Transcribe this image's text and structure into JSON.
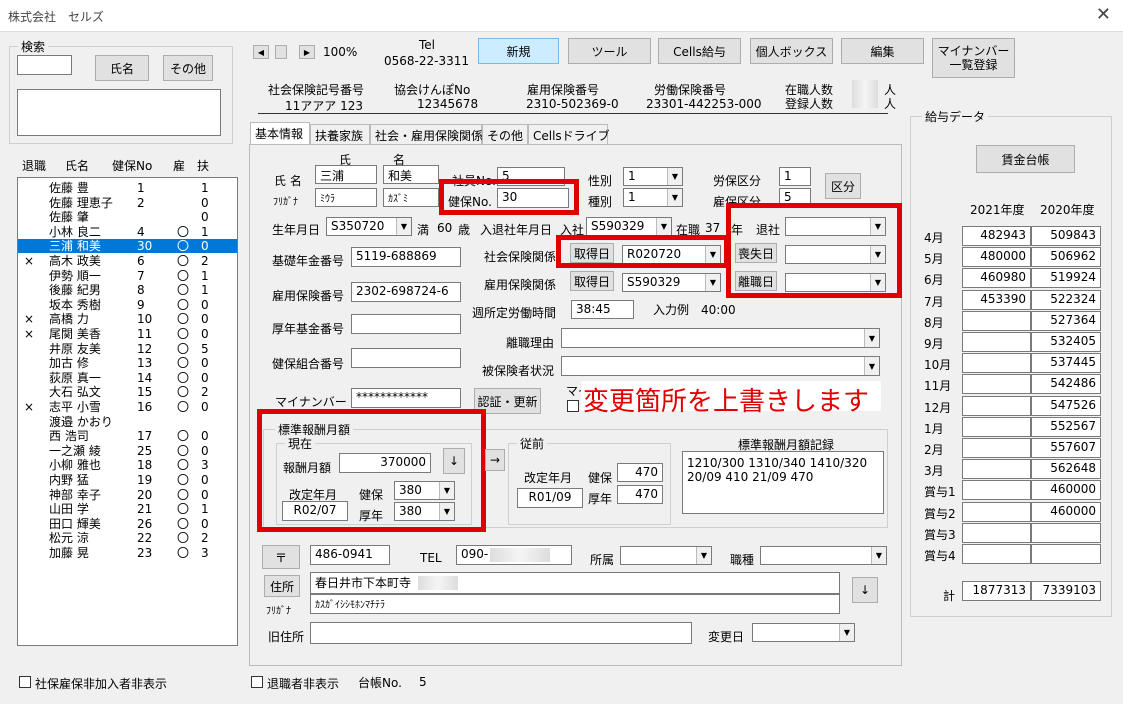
{
  "window": {
    "title": "株式会社　セルズ",
    "close": "✕"
  },
  "search": {
    "title": "検索",
    "name_btn": "氏名",
    "other_btn": "その他"
  },
  "list": {
    "headers": [
      "退職",
      "氏名",
      "健保No",
      "扶",
      "扶"
    ],
    "header_labels": {
      "retire": "退職",
      "name": "氏名",
      "no": "健保No",
      "ko": "雇",
      "fu": "扶"
    },
    "rows": [
      {
        "m": "",
        "n": "佐藤 豊",
        "no": "1",
        "c": "",
        "f": "1"
      },
      {
        "m": "",
        "n": "佐藤 理恵子",
        "no": "2",
        "c": "",
        "f": "0"
      },
      {
        "m": "",
        "n": "佐藤 肇",
        "no": "",
        "c": "",
        "f": "0"
      },
      {
        "m": "",
        "n": "小林 良二",
        "no": "4",
        "c": "〇",
        "f": "1"
      },
      {
        "m": "",
        "n": "三浦 和美",
        "no": "30",
        "c": "〇",
        "f": "0"
      },
      {
        "m": "×",
        "n": "高木 政美",
        "no": "6",
        "c": "〇",
        "f": "2"
      },
      {
        "m": "",
        "n": "伊勢 順一",
        "no": "7",
        "c": "〇",
        "f": "1"
      },
      {
        "m": "",
        "n": "後藤 紀男",
        "no": "8",
        "c": "〇",
        "f": "1"
      },
      {
        "m": "",
        "n": "坂本 秀樹",
        "no": "9",
        "c": "〇",
        "f": "0"
      },
      {
        "m": "×",
        "n": "高橋 力",
        "no": "10",
        "c": "〇",
        "f": "0"
      },
      {
        "m": "×",
        "n": "尾関 美香",
        "no": "11",
        "c": "〇",
        "f": "0"
      },
      {
        "m": "",
        "n": "井原 友美",
        "no": "12",
        "c": "〇",
        "f": "5"
      },
      {
        "m": "",
        "n": "加古 修",
        "no": "13",
        "c": "〇",
        "f": "0"
      },
      {
        "m": "",
        "n": "荻原 真一",
        "no": "14",
        "c": "〇",
        "f": "0"
      },
      {
        "m": "",
        "n": "大石 弘文",
        "no": "15",
        "c": "〇",
        "f": "2"
      },
      {
        "m": "×",
        "n": "志平 小雪",
        "no": "16",
        "c": "〇",
        "f": "0"
      },
      {
        "m": "",
        "n": "渡邉 かおり",
        "no": "",
        "c": "",
        "f": ""
      },
      {
        "m": "",
        "n": "西 浩司",
        "no": "17",
        "c": "〇",
        "f": "0"
      },
      {
        "m": "",
        "n": "一之瀬 綾",
        "no": "25",
        "c": "〇",
        "f": "0"
      },
      {
        "m": "",
        "n": "小柳 雅也",
        "no": "18",
        "c": "〇",
        "f": "3"
      },
      {
        "m": "",
        "n": "内野 猛",
        "no": "19",
        "c": "〇",
        "f": "0"
      },
      {
        "m": "",
        "n": "神部 幸子",
        "no": "20",
        "c": "〇",
        "f": "0"
      },
      {
        "m": "",
        "n": "山田 学",
        "no": "21",
        "c": "〇",
        "f": "1"
      },
      {
        "m": "",
        "n": "田口 輝美",
        "no": "26",
        "c": "〇",
        "f": "0"
      },
      {
        "m": "",
        "n": "松元 涼",
        "no": "22",
        "c": "〇",
        "f": "2"
      },
      {
        "m": "",
        "n": "加藤 晃",
        "no": "23",
        "c": "〇",
        "f": "3"
      }
    ],
    "selected_index": 4
  },
  "bottom": {
    "hide_unenrolled": "社保雇保非加入者非表示",
    "hide_retired": "退職者非表示",
    "ledger_label": "台帳No.",
    "ledger_no": "5"
  },
  "toolbar": {
    "zoom": "100%",
    "tel_label": "Tel",
    "tel": "0568-22-3311",
    "buttons": [
      "新規",
      "ツール",
      "Cells給与",
      "個人ボックス",
      "編集"
    ],
    "mynumber_btn": "マイナンバー\n一覧登録"
  },
  "company": {
    "shaho_label": "社会保険記号番号",
    "shaho": "11アアア 123",
    "kyokai_label": "協会けんぽNo",
    "kyokai": "12345678",
    "koyo_label": "雇用保険番号",
    "koyo": "2310-502369-0",
    "rodo_label": "労働保険番号",
    "rodo": "23301-442253-000",
    "zaishoku_label": "在職人数",
    "toroku_label": "登録人数",
    "unit": "人"
  },
  "tabs": [
    "基本情報",
    "扶養家族",
    "社会・雇用保険関係",
    "その他",
    "Cellsドライブ"
  ],
  "basic": {
    "sei_label": "氏",
    "mei_label": "名",
    "name_label": "氏 名",
    "furi_label": "ﾌﾘｶﾞﾅ",
    "sei": "三浦",
    "mei": "和美",
    "sei_kana": "ﾐｳﾗ",
    "mei_kana": "ｶｽﾞﾐ",
    "shain_label": "社員No.",
    "shain": "5",
    "kenpo_label": "健保No.",
    "kenpo": "30",
    "seibetsu_label": "性別",
    "seibetsu": "1",
    "shubetsu_label": "種別",
    "shubetsu": "1",
    "rodo_kubun_label": "労保区分",
    "rodo_kubun": "1",
    "koho_kubun_label": "雇保区分",
    "koho_kubun": "5",
    "kubun_btn": "区分",
    "birth_label": "生年月日",
    "birth": "S350720",
    "age_prefix": "満",
    "age": "60",
    "age_unit": "歳",
    "nyutai_label": "入退社年月日",
    "nyusha_label": "入社",
    "nyusha": "S590329",
    "zaishoku_label": "在職",
    "zaishoku": "37",
    "zaishoku_unit": "年",
    "taisha_label": "退社",
    "kiso_label": "基礎年金番号",
    "kiso": "5119-688869",
    "koyo_label": "雇用保険番号",
    "koyo": "2302-698724-6",
    "kosei_label": "厚年基金番号",
    "kenpo_kumiai_label": "健保組合番号",
    "shakai_label": "社会保険関係",
    "shutoku_btn": "取得日",
    "shakai_shutoku": "R020720",
    "soshitsu_btn": "喪失日",
    "koyo_kankei_label": "雇用保険関係",
    "koyo_shutoku": "S590329",
    "rishoku_btn": "離職日",
    "rodo_jikan_label": "週所定労働時間",
    "rodo_jikan": "38:45",
    "example": "入力例　40:00",
    "rishoku_riyu_label": "離職理由",
    "hihoken_label": "被保険者状況",
    "mynumber_label": "マイナンバー",
    "mynumber": "************",
    "ninsho_btn": "認証・更新",
    "mynumber_partial": "マイ",
    "overlay": "変更箇所を上書きします"
  },
  "hyojun": {
    "title": "標準報酬月額",
    "current_title": "現在",
    "getsugaku_label": "報酬月額",
    "getsugaku": "370000",
    "kaitei_label": "改定年月",
    "kaitei": "R02/07",
    "kenpo_label": "健保",
    "kenpo": "380",
    "kounen_label": "厚年",
    "kounen": "380",
    "prev_title": "従前",
    "prev_kaitei": "R01/09",
    "prev_kenpo": "470",
    "prev_kounen": "470",
    "record_title": "標準報酬月額記録",
    "record": "1210/300 1310/340 1410/320\n20/09 410 21/09 470"
  },
  "address": {
    "zip_btn": "〒",
    "zip": "486-0941",
    "tel_label": "TEL",
    "tel": "090-",
    "shozoku_label": "所属",
    "shokushu_label": "職種",
    "addr_btn": "住所",
    "furi_label": "ﾌﾘｶﾞﾅ",
    "addr": "春日井市下本町寺",
    "addr_kana": "ｶｽｶﾞｲｼｼﾓﾎﾝﾏﾁﾃﾗ",
    "old_label": "旧住所",
    "change_label": "変更日"
  },
  "kyuyo": {
    "title": "給与データ",
    "ledger_btn": "賃金台帳",
    "col1": "2021年度",
    "col2": "2020年度",
    "rows": [
      {
        "m": "4月",
        "a": "482943",
        "b": "509843"
      },
      {
        "m": "5月",
        "a": "480000",
        "b": "506962"
      },
      {
        "m": "6月",
        "a": "460980",
        "b": "519924"
      },
      {
        "m": "7月",
        "a": "453390",
        "b": "522324"
      },
      {
        "m": "8月",
        "a": "",
        "b": "527364"
      },
      {
        "m": "9月",
        "a": "",
        "b": "532405"
      },
      {
        "m": "10月",
        "a": "",
        "b": "537445"
      },
      {
        "m": "11月",
        "a": "",
        "b": "542486"
      },
      {
        "m": "12月",
        "a": "",
        "b": "547526"
      },
      {
        "m": "1月",
        "a": "",
        "b": "552567"
      },
      {
        "m": "2月",
        "a": "",
        "b": "557607"
      },
      {
        "m": "3月",
        "a": "",
        "b": "562648"
      },
      {
        "m": "賞与1",
        "a": "",
        "b": "460000"
      },
      {
        "m": "賞与2",
        "a": "",
        "b": "460000"
      },
      {
        "m": "賞与3",
        "a": "",
        "b": ""
      },
      {
        "m": "賞与4",
        "a": "",
        "b": ""
      }
    ],
    "total_label": "計",
    "total_a": "1877313",
    "total_b": "7339103"
  },
  "colors": {
    "red": "#e00000",
    "select": "#0078d7",
    "blue_btn": "#ccecff"
  }
}
